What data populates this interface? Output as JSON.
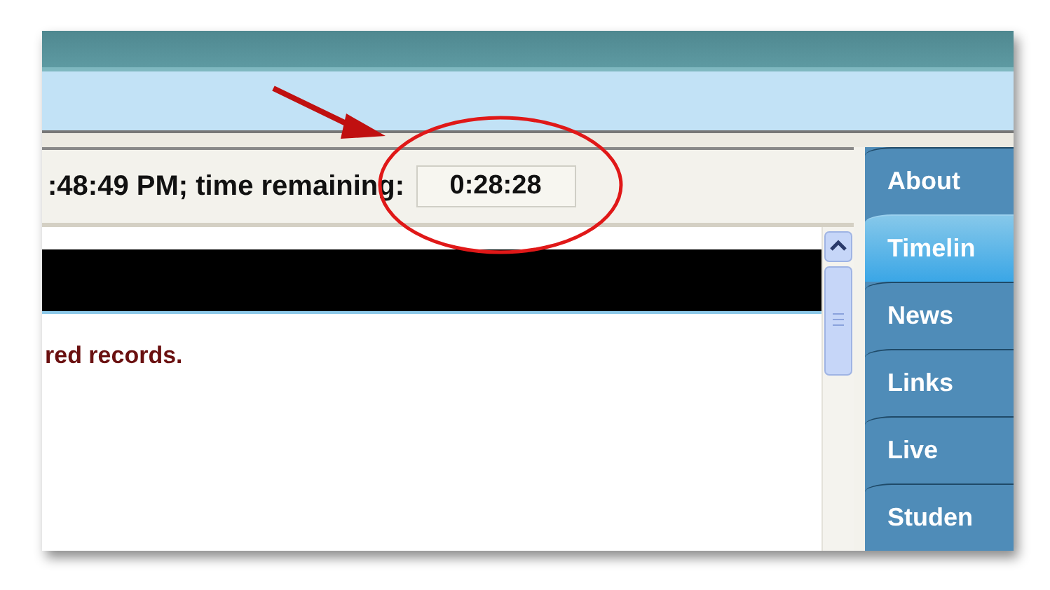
{
  "status": {
    "label": ":48:49 PM; time remaining:",
    "value": "0:28:28"
  },
  "content": {
    "message": "red records."
  },
  "nav_tabs": [
    {
      "label": "About",
      "selected": false
    },
    {
      "label": "Timelin",
      "selected": true
    },
    {
      "label": "News",
      "selected": false
    },
    {
      "label": "Links",
      "selected": false
    },
    {
      "label": "Live",
      "selected": false
    },
    {
      "label": "Studen",
      "selected": false
    }
  ]
}
